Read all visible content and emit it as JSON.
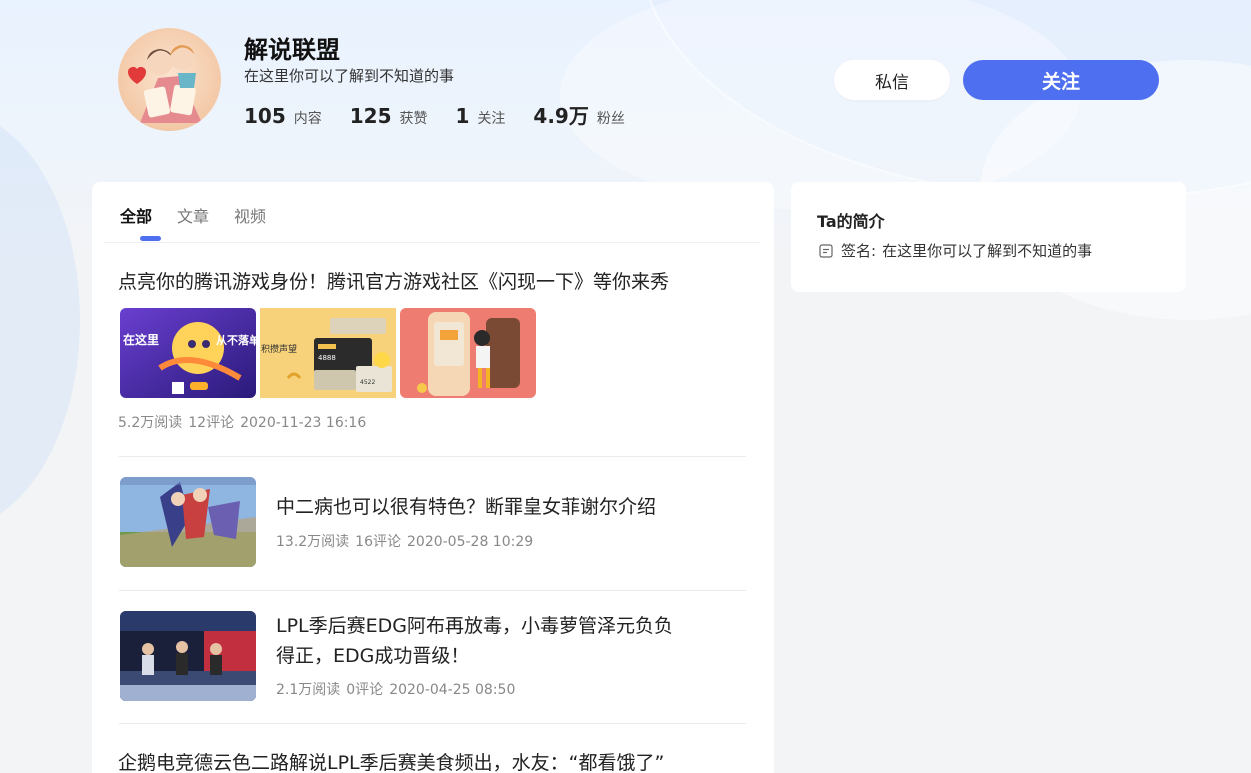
{
  "profile": {
    "name": "解说联盟",
    "signature": "在这里你可以了解到不知道的事",
    "stats": [
      {
        "num": "105",
        "label": "内容"
      },
      {
        "num": "125",
        "label": "获赞"
      },
      {
        "num": "1",
        "label": "关注"
      },
      {
        "num": "4.9万",
        "label": "粉丝"
      }
    ]
  },
  "actions": {
    "message_label": "私信",
    "follow_label": "关注"
  },
  "tabs": [
    {
      "label": "全部",
      "active": true
    },
    {
      "label": "文章",
      "active": false
    },
    {
      "label": "视频",
      "active": false
    }
  ],
  "feed": [
    {
      "title": "点亮你的腾讯游戏身份！腾讯官方游戏社区《闪现一下》等你来秀",
      "reads": "5.2万阅读",
      "comments": "12评论",
      "time": "2020-11-23 16:16",
      "thumb_texts": [
        "在这里",
        "从不落单",
        "积攒声望",
        "4888",
        "4522"
      ]
    },
    {
      "title": "中二病也可以很有特色？断罪皇女菲谢尔介绍",
      "reads": "13.2万阅读",
      "comments": "16评论",
      "time": "2020-05-28 10:29"
    },
    {
      "title_line1": "LPL季后赛EDG阿布再放毒，小毒萝管泽元负负",
      "title_line2": "得正，EDG成功晋级！",
      "reads": "2.1万阅读",
      "comments": "0评论",
      "time": "2020-04-25 08:50"
    },
    {
      "title": "企鹅电竞德云色二路解说LPL季后赛美食频出，水友：“都看饿了”"
    }
  ],
  "intro": {
    "title": "Ta的简介",
    "signature_label": "签名:",
    "signature_text": "在这里你可以了解到不知道的事"
  },
  "colors": {
    "accent": "#4d6ff0",
    "page_bg": "#f3f4f6",
    "card_bg": "#ffffff"
  }
}
